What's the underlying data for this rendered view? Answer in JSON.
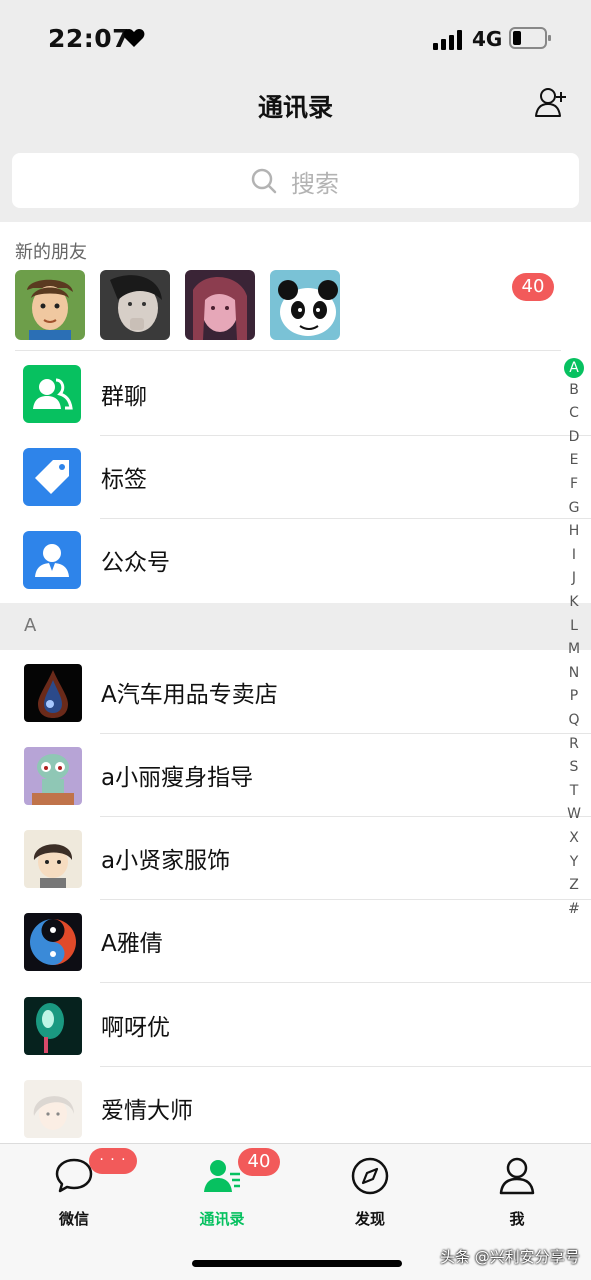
{
  "status_bar": {
    "time": "22:07",
    "network": "4G"
  },
  "nav": {
    "title": "通讯录",
    "add_icon": "add-friend-icon"
  },
  "search": {
    "placeholder": "搜索"
  },
  "new_friends": {
    "label": "新的朋友",
    "badge": "40"
  },
  "functions": [
    {
      "label": "群聊",
      "icon": "group-chat-icon",
      "color": "#07c160"
    },
    {
      "label": "标签",
      "icon": "tag-icon",
      "color": "#2e84ea"
    },
    {
      "label": "公众号",
      "icon": "official-account-icon",
      "color": "#2e84ea"
    }
  ],
  "section": {
    "letter": "A"
  },
  "contacts": [
    {
      "name": "A汽车用品专卖店"
    },
    {
      "name": "a小丽瘦身指导"
    },
    {
      "name": "a小贤家服饰"
    },
    {
      "name": "A雅倩"
    },
    {
      "name": "啊呀优"
    },
    {
      "name": "爱情大师"
    }
  ],
  "index": [
    "A",
    "B",
    "C",
    "D",
    "E",
    "F",
    "G",
    "H",
    "I",
    "J",
    "K",
    "L",
    "M",
    "N",
    "P",
    "Q",
    "R",
    "S",
    "T",
    "W",
    "X",
    "Y",
    "Z",
    "#"
  ],
  "tabs": [
    {
      "label": "微信",
      "badge": "· · ·",
      "active": false
    },
    {
      "label": "通讯录",
      "badge": "40",
      "active": true
    },
    {
      "label": "发现",
      "active": false
    },
    {
      "label": "我",
      "active": false
    }
  ],
  "watermark": "头条 @兴利安分享号",
  "colors": {
    "accent": "#07c160",
    "badge": "#f25a5a",
    "blue": "#2e84ea"
  }
}
